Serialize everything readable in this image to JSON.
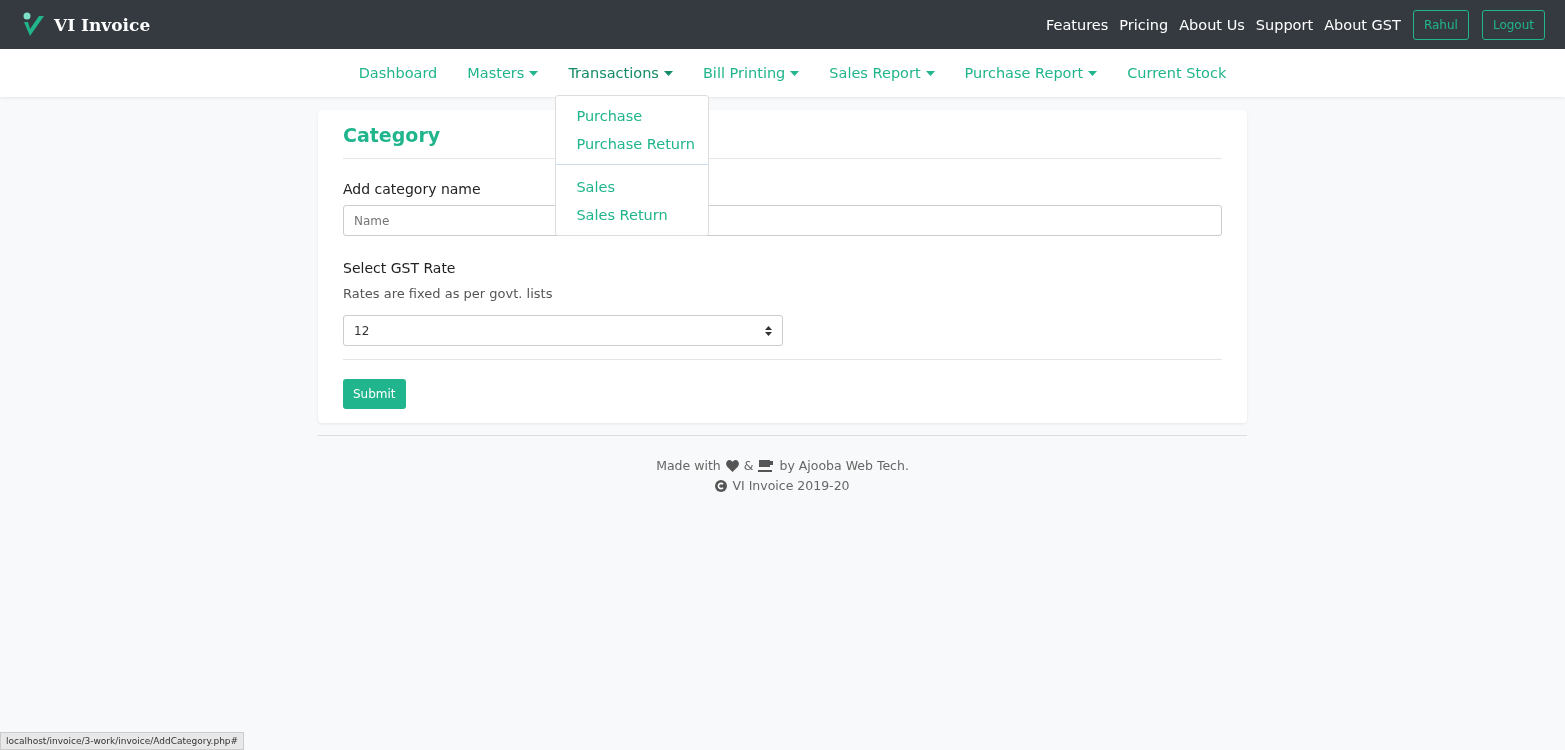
{
  "brand": {
    "name": "VI Invoice"
  },
  "top_links": [
    "Features",
    "Pricing",
    "About Us",
    "Support",
    "About GST"
  ],
  "top_buttons": [
    "Rahul",
    "Logout"
  ],
  "menu": [
    {
      "label": "Dashboard",
      "kind": "link",
      "expanded": false
    },
    {
      "label": "Masters",
      "kind": "dropdown",
      "expanded": false
    },
    {
      "label": "Transactions",
      "kind": "dropdown",
      "expanded": true,
      "groups": [
        [
          "Purchase",
          "Purchase Return"
        ],
        [
          "Sales",
          "Sales Return"
        ]
      ]
    },
    {
      "label": "Bill Printing",
      "kind": "dropdown",
      "expanded": false
    },
    {
      "label": "Sales Report",
      "kind": "dropdown",
      "expanded": false
    },
    {
      "label": "Purchase Report",
      "kind": "dropdown",
      "expanded": false
    },
    {
      "label": "Current Stock",
      "kind": "link",
      "expanded": false
    }
  ],
  "card": {
    "title": "Category",
    "name_label": "Add category name",
    "name_placeholder": "Name",
    "gst_label": "Select GST Rate",
    "gst_hint": "Rates are fixed as per govt. lists",
    "gst_value": "12",
    "submit": "Submit"
  },
  "footer": {
    "made_with": "Made with",
    "amp": "&",
    "by": "by Ajooba Web Tech.",
    "copyright": "VI Invoice 2019-20"
  },
  "status_url": "localhost/invoice/3-work/invoice/AddCategory.php#"
}
